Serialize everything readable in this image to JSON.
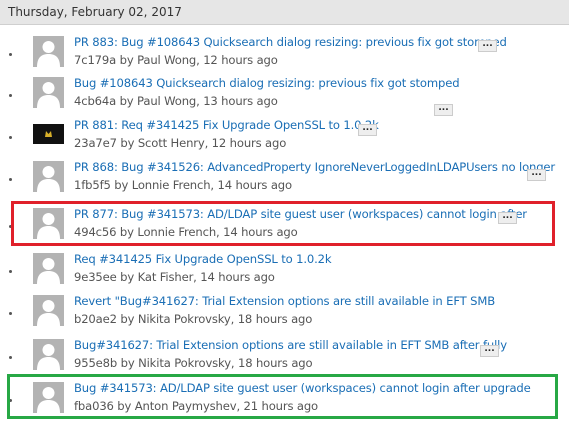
{
  "date_header": "Thursday, February 02, 2017",
  "more_label": "...",
  "commits": [
    {
      "title": "PR 883: Bug #108643 Quicksearch dialog resizing: previous fix got stomped",
      "meta": "7c179a by Paul Wong, 12 hours ago",
      "avatar_icon": "default-user-avatar-icon"
    },
    {
      "title": "Bug #108643 Quicksearch dialog resizing: previous fix got stomped",
      "meta": "4cb64a by Paul Wong, 13 hours ago",
      "avatar_icon": "default-user-avatar-icon"
    },
    {
      "title": "PR 881: Req #341425 Fix Upgrade OpenSSL to 1.0.2k",
      "meta": "23a7e7 by Scott Henry, 12 hours ago",
      "avatar_icon": "custom-user-avatar-icon"
    },
    {
      "title": "PR 868: Bug #341526: AdvancedProperty IgnoreNeverLoggedInLDAPUsers no longer",
      "meta": "1fb5f5 by Lonnie French, 14 hours ago",
      "avatar_icon": "default-user-avatar-icon"
    },
    {
      "title": "PR 877: Bug #341573: AD/LDAP site guest user (workspaces) cannot login after",
      "meta": "494c56 by Lonnie French, 14 hours ago",
      "avatar_icon": "default-user-avatar-icon"
    },
    {
      "title": "Req #341425 Fix Upgrade OpenSSL to 1.0.2k",
      "meta": "9e35ee by Kat Fisher, 14 hours ago",
      "avatar_icon": "default-user-avatar-icon"
    },
    {
      "title": "Revert \"Bug#341627: Trial Extension options are still available in EFT SMB",
      "meta": "b20ae2 by Nikita Pokrovsky, 18 hours ago",
      "avatar_icon": "default-user-avatar-icon"
    },
    {
      "title": "Bug#341627: Trial Extension options are still available in EFT SMB after fully",
      "meta": "955e8b by Nikita Pokrovsky, 18 hours ago",
      "avatar_icon": "default-user-avatar-icon"
    },
    {
      "title": "Bug #341573: AD/LDAP site guest user (workspaces) cannot login after upgrade",
      "meta": "fba036 by Anton Paymyshev, 21 hours ago",
      "avatar_icon": "default-user-avatar-icon"
    }
  ],
  "highlights": {
    "red_color": "#e0202a",
    "green_color": "#27a845"
  }
}
